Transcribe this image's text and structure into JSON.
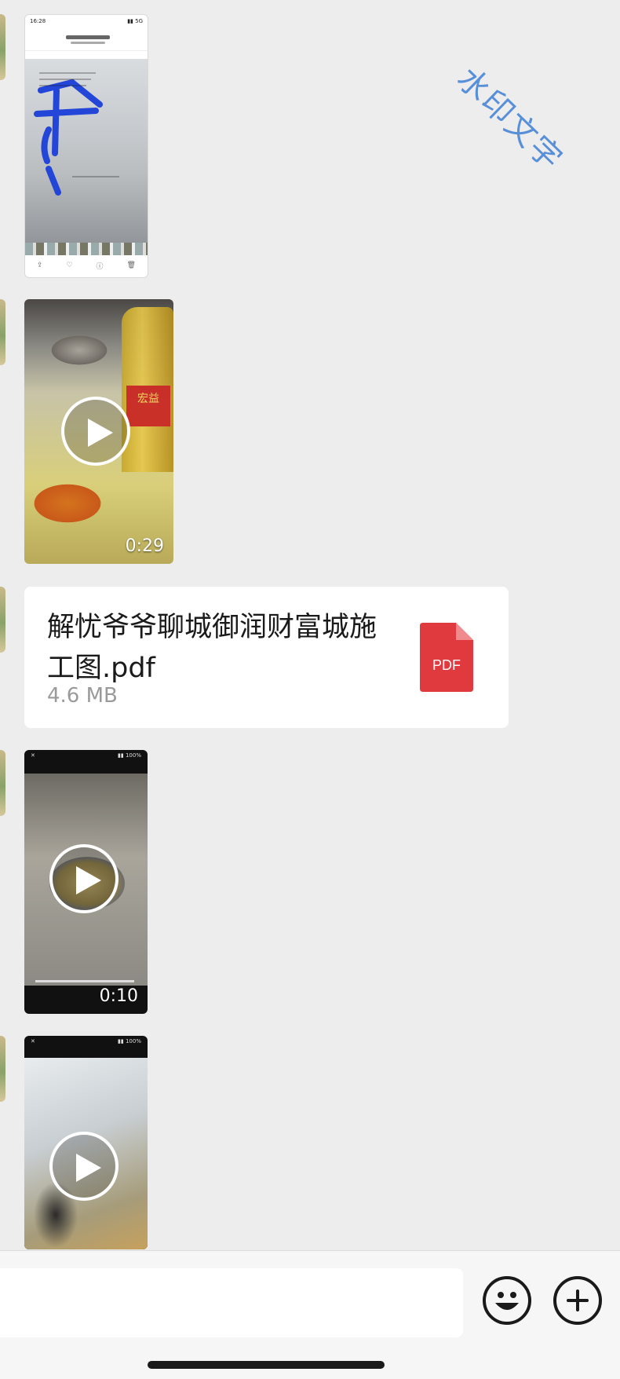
{
  "watermark": {
    "text": "水印文字",
    "color": "#3f7fd6"
  },
  "messages": [
    {
      "type": "image",
      "description_icon": "screenshot-thumbnail"
    },
    {
      "type": "video",
      "duration": "0:29",
      "label_text": "宏益"
    },
    {
      "type": "file",
      "file_name": "解忧爷爷聊城御润财富城施工图.pdf",
      "file_size": "4.6 MB",
      "icon_label": "PDF",
      "icon_color": "#e0393e"
    },
    {
      "type": "video",
      "duration": "0:10"
    },
    {
      "type": "video",
      "duration": ""
    }
  ],
  "input_bar": {
    "input_value": "",
    "emoji_icon": "smiley-icon",
    "plus_icon": "plus-icon"
  },
  "colors": {
    "background": "#ededed",
    "bubble": "#ffffff",
    "file_size_text": "#9a9a9a"
  }
}
